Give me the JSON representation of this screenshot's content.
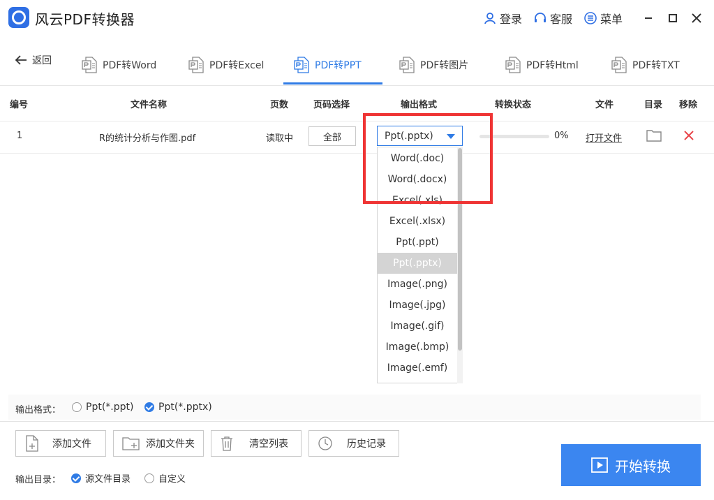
{
  "app": {
    "title": "风云PDF转换器",
    "login_label": "登录",
    "service_label": "客服",
    "menu_label": "菜单"
  },
  "nav": {
    "back_label": "返回",
    "tabs": [
      {
        "label": "PDF转Word",
        "icon": "pdf-word-icon"
      },
      {
        "label": "PDF转Excel",
        "icon": "pdf-excel-icon"
      },
      {
        "label": "PDF转PPT",
        "icon": "pdf-ppt-icon",
        "active": true
      },
      {
        "label": "PDF转图片",
        "icon": "pdf-image-icon"
      },
      {
        "label": "PDF转Html",
        "icon": "pdf-html-icon"
      },
      {
        "label": "PDF转TXT",
        "icon": "pdf-txt-icon"
      }
    ]
  },
  "table": {
    "headers": {
      "index": "编号",
      "filename": "文件名称",
      "pages": "页数",
      "page_select": "页码选择",
      "output_format": "输出格式",
      "status": "转换状态",
      "file": "文件",
      "directory": "目录",
      "remove": "移除"
    },
    "rows": [
      {
        "index": "1",
        "filename": "R的统计分析与作图.pdf",
        "pages": "读取中",
        "page_select": "全部",
        "output_format": "Ppt(.pptx)",
        "progress": 0,
        "progress_text": "0%",
        "open_file": "打开文件"
      }
    ]
  },
  "dropdown": {
    "options": [
      "Word(.doc)",
      "Word(.docx)",
      "Excel(.xls)",
      "Excel(.xlsx)",
      "Ppt(.ppt)",
      "Ppt(.pptx)",
      "Image(.png)",
      "Image(.jpg)",
      "Image(.gif)",
      "Image(.bmp)",
      "Image(.emf)"
    ],
    "selected": "Ppt(.pptx)"
  },
  "output_format": {
    "label": "输出格式：",
    "options": [
      {
        "label": "Ppt(*.ppt)",
        "checked": false
      },
      {
        "label": "Ppt(*.pptx)",
        "checked": true
      }
    ]
  },
  "actions": {
    "add_file": "添加文件",
    "add_folder": "添加文件夹",
    "clear_list": "清空列表",
    "history": "历史记录"
  },
  "output_dir": {
    "label": "输出目录：",
    "options": [
      {
        "label": "源文件目录",
        "checked": true
      },
      {
        "label": "自定义",
        "checked": false
      }
    ]
  },
  "start_button": "开始转换",
  "colors": {
    "accent": "#2f7be5",
    "start_button": "#3b86f0",
    "highlight_box": "#ef3434",
    "remove_icon": "#e8474c"
  }
}
